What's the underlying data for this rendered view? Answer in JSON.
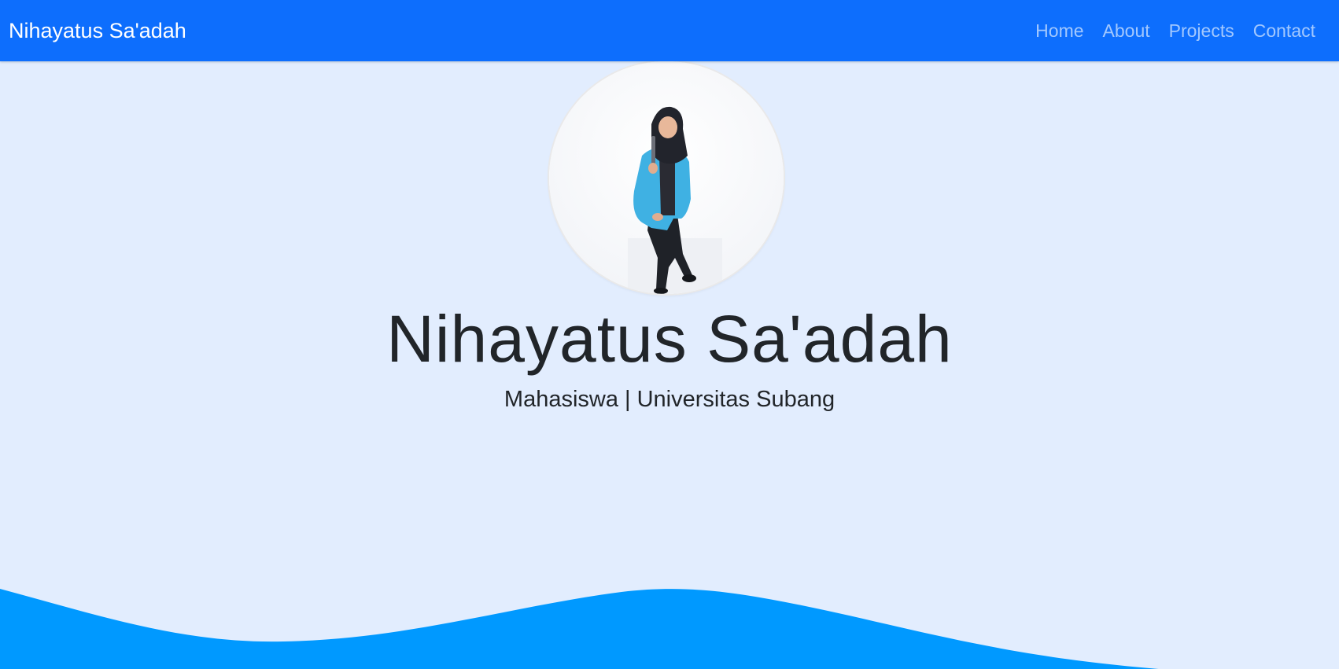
{
  "navbar": {
    "brand": "Nihayatus Sa'adah",
    "links": [
      {
        "label": "Home"
      },
      {
        "label": "About"
      },
      {
        "label": "Projects"
      },
      {
        "label": "Contact"
      }
    ]
  },
  "hero": {
    "name": "Nihayatus Sa'adah",
    "subtitle": "Mahasiswa | Universitas Subang",
    "photo_icon": "profile-photo"
  },
  "colors": {
    "navbar": "#0d6efd",
    "background": "#e2edfe",
    "wave": "#0099ff"
  }
}
